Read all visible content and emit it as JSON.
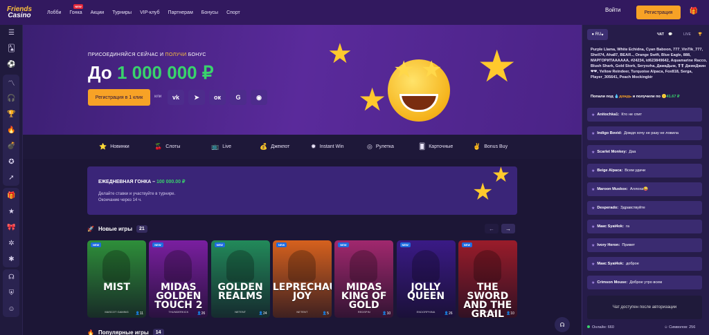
{
  "brand": {
    "line1": "Friends",
    "line2": "Casino"
  },
  "nav": {
    "items": [
      "Лобби",
      "Гонка",
      "Акции",
      "Турниры",
      "VIP-клуб",
      "Партнерам",
      "Бонусы",
      "Спорт"
    ],
    "new_tag": "NEW"
  },
  "header": {
    "login": "Войти",
    "register": "Регистрация"
  },
  "sidebar": {
    "icons": [
      "menu-icon",
      "cards-icon",
      "football-icon",
      "trending-icon",
      "headphones-icon",
      "trophy-icon",
      "fire-icon",
      "bomb-icon",
      "star-icon",
      "rocket-icon",
      "gift-icon",
      "favorite-icon",
      "present-icon",
      "wheel-icon",
      "lightning-icon",
      "support-icon",
      "shield-icon",
      "account-icon"
    ]
  },
  "hero": {
    "tagline_pre": "ПРИСОЕДИНЯЙСЯ СЕЙЧАС И ",
    "tagline_hl": "ПОЛУЧИ",
    "tagline_post": " БОНУС",
    "amount_pre": "До ",
    "amount_num": "1 000 000 ₽",
    "register_btn": "Регистрация в 1 клик",
    "or": "или",
    "social": [
      "VK",
      "TG",
      "OK",
      "G",
      "ST"
    ]
  },
  "categories": [
    "Новинки",
    "Слоты",
    "Live",
    "Джекпот",
    "Instant Win",
    "Рулетка",
    "Карточные",
    "Bonus Buy"
  ],
  "race": {
    "title_pre": "ЕЖЕДНЕВНАЯ ГОНКА – ",
    "title_amount": "100 000.00 ₽",
    "desc1": "Делайте ставки и участвуйте в турнире.",
    "desc2": "Окончание через 14 ч."
  },
  "new_games": {
    "title": "Новые игры",
    "count": "21"
  },
  "popular_games": {
    "title": "Популярные игры",
    "count": "14"
  },
  "games": [
    {
      "title": "MIST",
      "provider": "MASCOT GAMING",
      "players": "11",
      "new": "NEW",
      "bg": "#2e8f3a"
    },
    {
      "title": "MIDAS GOLDEN TOUCH 2",
      "provider": "THUNDERKICK",
      "players": "26",
      "new": "NEW",
      "bg": "#7a1fa0"
    },
    {
      "title": "GOLDEN REALMS",
      "provider": "NETENT",
      "players": "24",
      "new": "NEW",
      "bg": "#228a5a"
    },
    {
      "title": "LEPRECHAUN JOY",
      "provider": "NETENT",
      "players": "5",
      "new": "NEW",
      "bg": "#d6611e"
    },
    {
      "title": "MIDAS KING OF GOLD",
      "provider": "REDSPIN",
      "players": "10",
      "new": "NEW",
      "bg": "#a1286e"
    },
    {
      "title": "JOLLY QUEEN",
      "provider": "ENDORPHINA",
      "players": "26",
      "new": "NEW",
      "bg": "#3a1a86"
    },
    {
      "title": "THE SWORD AND THE GRAIL EXCALIBUR",
      "provider": "PLAY'N GO",
      "players": "10",
      "new": "NEW",
      "bg": "#9a1c2a"
    }
  ],
  "chat": {
    "lang": "RU",
    "tab_chat": "ЧАТ",
    "tab_live": "LIVE",
    "rain_names": "Purple Llama, White Echidna, Cyan Baboon, 777_VinTik_777, Shell74, Aha87, BEAR.., Orange Swift, Blue Eagle, 888, МАРГОРИТАААААА, #24234, id623849642, Aquamarine Racco, Blush Shark, Gold Stork, Seryozha, ДамаДым, ❣❣ ДжинДжин ❤❤, Yellow Reindeer, Turquoise Alpaca, Fox818, Serga, Player_305641, Peach Mockingbir",
    "rain_pre": "Попали под ",
    "rain_word": "дождь",
    "rain_mid": " и получили по ",
    "rain_amount": "41.67 ₽",
    "messages": [
      {
        "name": "Anitochka1:",
        "text": "Кто не спит"
      },
      {
        "name": "Indigo Bovid:",
        "text": "Дождя хочу не разу не ловила"
      },
      {
        "name": "Scarlet Monkey:",
        "text": "Даа"
      },
      {
        "name": "Beige Alpaca:",
        "text": "Всем удачи"
      },
      {
        "name": "Maroon Muskox:",
        "text": "Аллоха😜"
      },
      {
        "name": "Desperado:",
        "text": "Здравствуйте"
      },
      {
        "name": "Макс Syat4ok:",
        "text": "ra"
      },
      {
        "name": "Ivory Heron:",
        "text": "Привет"
      },
      {
        "name": "Макс Syat4ok:",
        "text": "доброе"
      },
      {
        "name": "Crimson Mouse:",
        "text": "Доброе утро всем"
      }
    ],
    "disabled": "Чат доступен после авторизации",
    "online_label": "Онлайн: 660",
    "symbols_label": "Символов: 256"
  }
}
